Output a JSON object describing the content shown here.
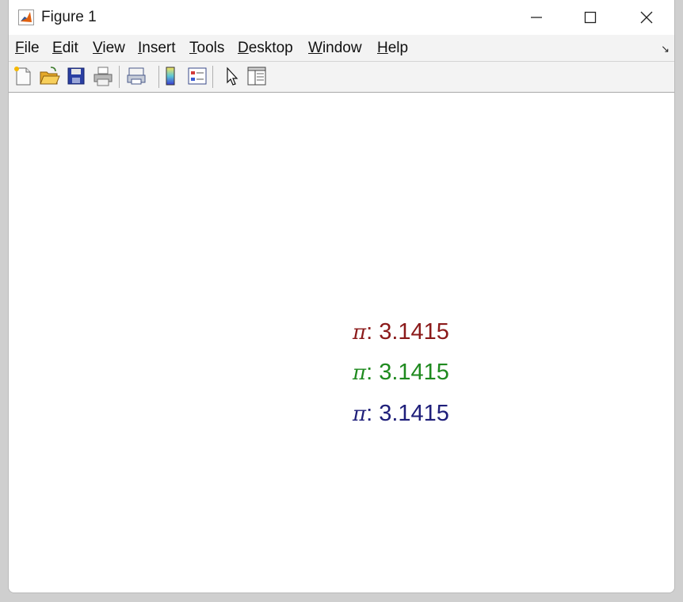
{
  "window": {
    "title": "Figure 1"
  },
  "menu": {
    "items": [
      {
        "u": "F",
        "rest": "ile"
      },
      {
        "u": "E",
        "rest": "dit"
      },
      {
        "u": "V",
        "rest": "iew"
      },
      {
        "u": "I",
        "rest": "nsert"
      },
      {
        "u": "T",
        "rest": "ools"
      },
      {
        "u": "D",
        "rest": "esktop"
      },
      {
        "u": "W",
        "rest": "indow"
      },
      {
        "u": "H",
        "rest": "elp"
      }
    ],
    "dock_glyph": "↘"
  },
  "toolbar": {
    "icons": [
      "new-figure-icon",
      "open-file-icon",
      "save-icon",
      "print-icon",
      "link-plot-icon",
      "colorbar-icon",
      "legend-icon",
      "edit-plot-arrow-icon",
      "property-inspector-icon"
    ]
  },
  "figure": {
    "lines": [
      {
        "symbol": "π",
        "text": ": 3.1415",
        "color": "#8b1a1a"
      },
      {
        "symbol": "π",
        "text": ": 3.1415",
        "color": "#1f8a1f"
      },
      {
        "symbol": "π",
        "text": ": 3.1415",
        "color": "#1f1f7a"
      }
    ]
  }
}
